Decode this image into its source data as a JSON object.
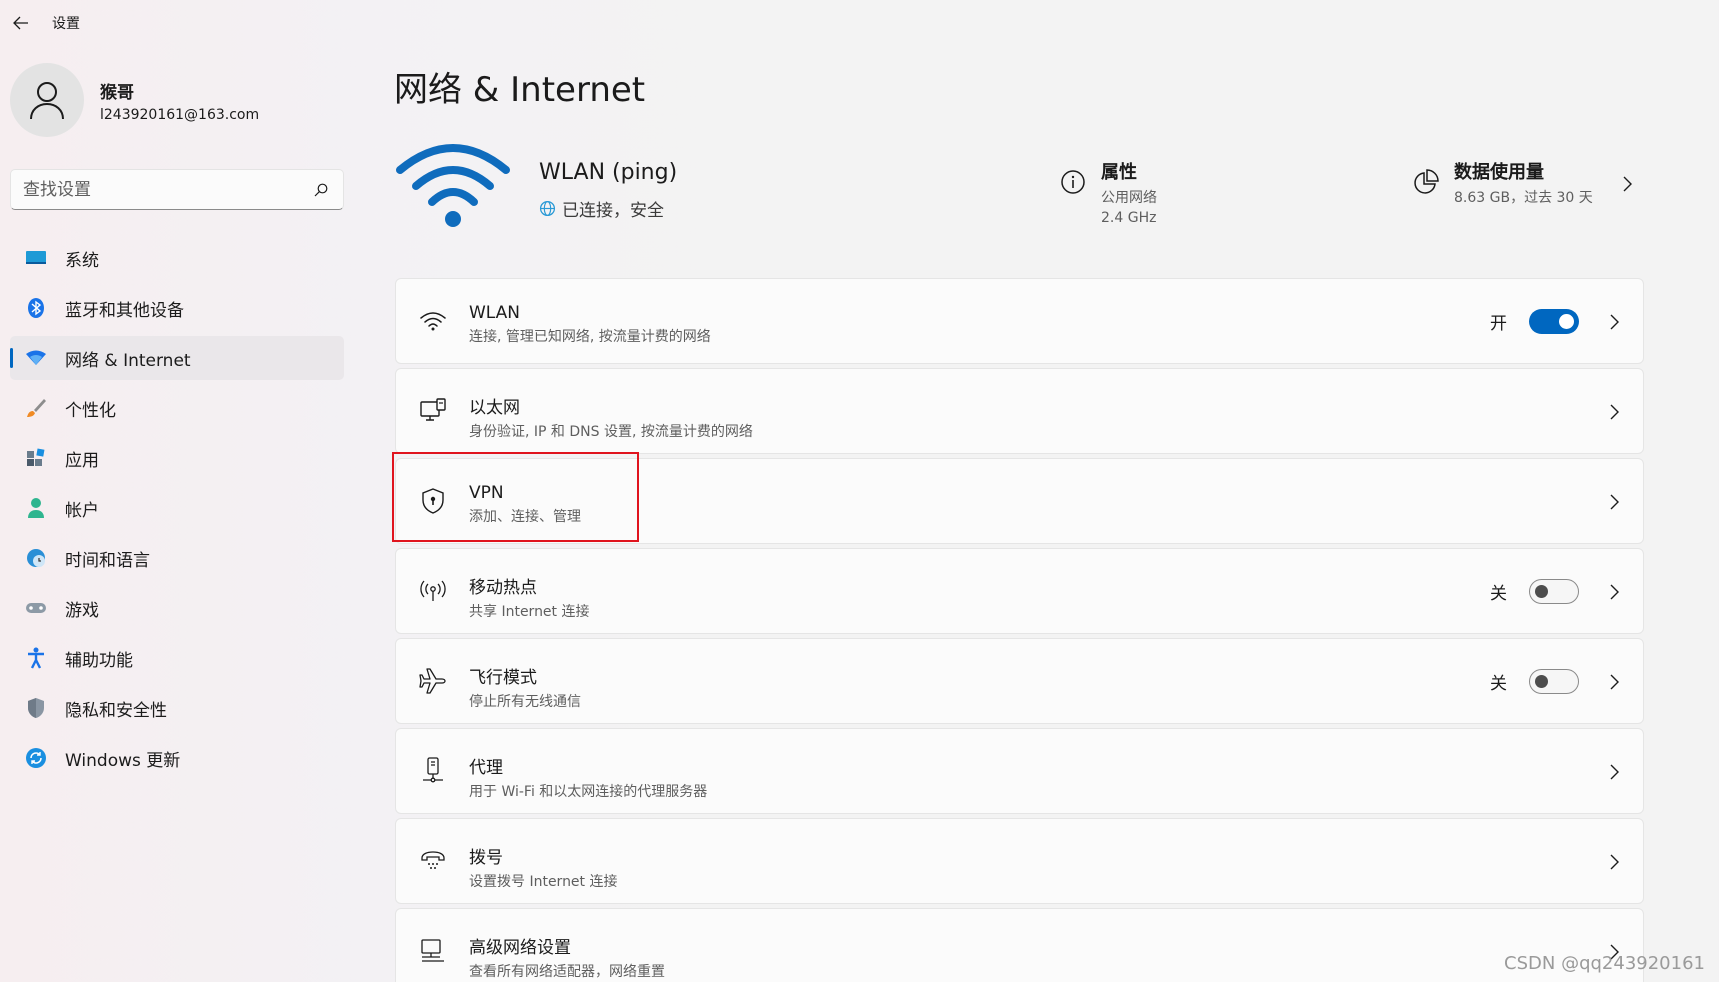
{
  "app": {
    "title": "设置"
  },
  "profile": {
    "name": "猴哥",
    "email": "l243920161@163.com"
  },
  "search": {
    "placeholder": "查找设置"
  },
  "sidebar": {
    "items": [
      {
        "label": "系统",
        "icon": "monitor-icon",
        "active": false
      },
      {
        "label": "蓝牙和其他设备",
        "icon": "bluetooth-icon",
        "active": false
      },
      {
        "label": "网络 & Internet",
        "icon": "wifi-icon",
        "active": true
      },
      {
        "label": "个性化",
        "icon": "brush-icon",
        "active": false
      },
      {
        "label": "应用",
        "icon": "apps-icon",
        "active": false
      },
      {
        "label": "帐户",
        "icon": "account-icon",
        "active": false
      },
      {
        "label": "时间和语言",
        "icon": "globe-clock-icon",
        "active": false
      },
      {
        "label": "游戏",
        "icon": "gamepad-icon",
        "active": false
      },
      {
        "label": "辅助功能",
        "icon": "accessibility-icon",
        "active": false
      },
      {
        "label": "隐私和安全性",
        "icon": "shield-icon",
        "active": false
      },
      {
        "label": "Windows 更新",
        "icon": "update-icon",
        "active": false
      }
    ]
  },
  "main": {
    "title": "网络 & Internet",
    "hero": {
      "network_name": "WLAN (ping)",
      "status": "已连接，安全",
      "properties": {
        "title": "属性",
        "line1": "公用网络",
        "line2": "2.4 GHz"
      },
      "usage": {
        "title": "数据使用量",
        "line1": "8.63 GB，过去 30 天"
      }
    },
    "rows": [
      {
        "title": "WLAN",
        "sub": "连接, 管理已知网络, 按流量计费的网络",
        "toggle_label": "开"
      },
      {
        "title": "以太网",
        "sub": "身份验证, IP 和 DNS 设置, 按流量计费的网络"
      },
      {
        "title": "VPN",
        "sub": "添加、连接、管理"
      },
      {
        "title": "移动热点",
        "sub": "共享 Internet 连接",
        "toggle_label": "关"
      },
      {
        "title": "飞行模式",
        "sub": "停止所有无线通信",
        "toggle_label": "关"
      },
      {
        "title": "代理",
        "sub": "用于 Wi-Fi 和以太网连接的代理服务器"
      },
      {
        "title": "拨号",
        "sub": "设置拨号 Internet 连接"
      },
      {
        "title": "高级网络设置",
        "sub": "查看所有网络适配器，网络重置"
      }
    ]
  },
  "watermark": "CSDN @qq243920161",
  "colors": {
    "accent": "#0067c0",
    "highlight": "#e0141e"
  }
}
